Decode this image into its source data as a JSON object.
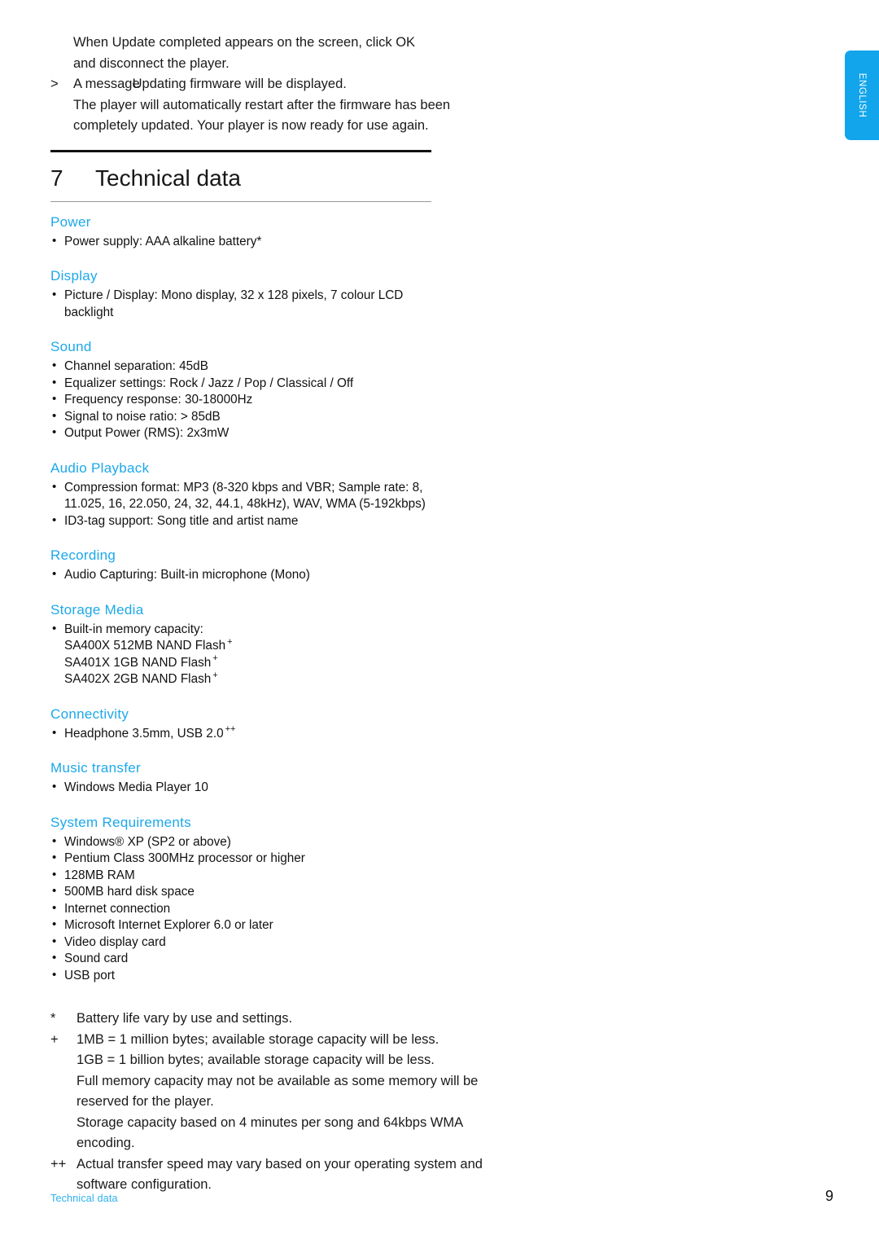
{
  "language_tab": {
    "label": "ENGLISH",
    "color": "#12A5EC"
  },
  "intro": {
    "line1": "When Update completed appears on the screen, click OK",
    "line2": "and disconnect the player.",
    "marker": ">",
    "line3_a": "A message",
    "line3_b": "Updating firmware",
    "line3_c": "will be displayed.",
    "line4": "The player will automatically restart after the firmware has been",
    "line5": "completely updated. Your player is now ready for use again."
  },
  "chapter": {
    "number": "7",
    "title": "Technical data"
  },
  "sections": [
    {
      "heading": "Power",
      "items": [
        {
          "bullet": "•",
          "text": "Power supply: AAA alkaline battery*"
        }
      ]
    },
    {
      "heading": "Display",
      "items": [
        {
          "bullet": "•",
          "text": "Picture / Display: Mono display, 32 x 128 pixels, 7 colour LCD",
          "cont": "backlight"
        }
      ]
    },
    {
      "heading": "Sound",
      "items": [
        {
          "bullet": "•",
          "text": "Channel separation: 45dB"
        },
        {
          "bullet": "•",
          "text": "Equalizer settings: Rock / Jazz / Pop / Classical / Off"
        },
        {
          "bullet": "•",
          "text": "Frequency response: 30-18000Hz"
        },
        {
          "bullet": "•",
          "text": "Signal to noise ratio: > 85dB"
        },
        {
          "bullet": "•",
          "text": "Output Power (RMS): 2x3mW"
        }
      ]
    },
    {
      "heading": "Audio Playback",
      "items": [
        {
          "bullet": "•",
          "text": "Compression format: MP3 (8-320 kbps and VBR; Sample rate: 8,",
          "cont": "11.025, 16, 22.050, 24, 32, 44.1, 48kHz), WAV, WMA (5-192kbps)"
        },
        {
          "bullet": "•",
          "text": "ID3-tag support: Song title and artist name"
        }
      ]
    },
    {
      "heading": "Recording",
      "items": [
        {
          "bullet": "•",
          "text": "Audio Capturing: Built-in microphone (Mono)"
        }
      ]
    },
    {
      "heading": "Storage Media",
      "items": [
        {
          "bullet": "•",
          "text": "Built-in memory capacity:"
        }
      ],
      "memory_lines": [
        {
          "model": "SA400X 512MB NAND Flash",
          "mark": "+"
        },
        {
          "model": "SA401X 1GB NAND Flash",
          "mark": "+"
        },
        {
          "model": "SA402X 2GB NAND Flash",
          "mark": "+"
        }
      ]
    },
    {
      "heading": "Connectivity",
      "items": [
        {
          "bullet": "•",
          "text": "Headphone 3.5mm, USB 2.0",
          "mark": "++"
        }
      ]
    },
    {
      "heading": "Music transfer",
      "items": [
        {
          "bullet": "•",
          "text": "Windows Media Player 10"
        }
      ]
    },
    {
      "heading": "System Requirements",
      "items": [
        {
          "bullet": "•",
          "text": "Windows® XP (SP2 or above)"
        },
        {
          "bullet": "•",
          "text": "Pentium Class 300MHz processor or higher"
        },
        {
          "bullet": "•",
          "text": "128MB RAM"
        },
        {
          "bullet": "•",
          "text": "500MB hard disk space"
        },
        {
          "bullet": "•",
          "text": "Internet connection"
        },
        {
          "bullet": "•",
          "text": "Microsoft Internet Explorer 6.0 or later"
        },
        {
          "bullet": "•",
          "text": "Video display card"
        },
        {
          "bullet": "•",
          "text": "Sound card"
        },
        {
          "bullet": "•",
          "text": "USB port"
        }
      ]
    }
  ],
  "footnotes": [
    {
      "mark": "*",
      "lines": [
        "Battery life vary by use and settings."
      ]
    },
    {
      "mark": "+",
      "lines": [
        "1MB = 1 million bytes; available storage capacity will be less.",
        "1GB = 1 billion bytes; available storage capacity will be less.",
        "Full memory capacity may not be available as some memory will be",
        "reserved for the player.",
        "Storage capacity based on 4 minutes per song and 64kbps WMA",
        "encoding."
      ]
    },
    {
      "mark": "++",
      "lines": [
        "Actual transfer speed may vary based on your operating system and",
        "software configuration."
      ]
    }
  ],
  "footer": {
    "label": "Technical data",
    "page_number": "9",
    "label_color": "#2BB0EE"
  }
}
